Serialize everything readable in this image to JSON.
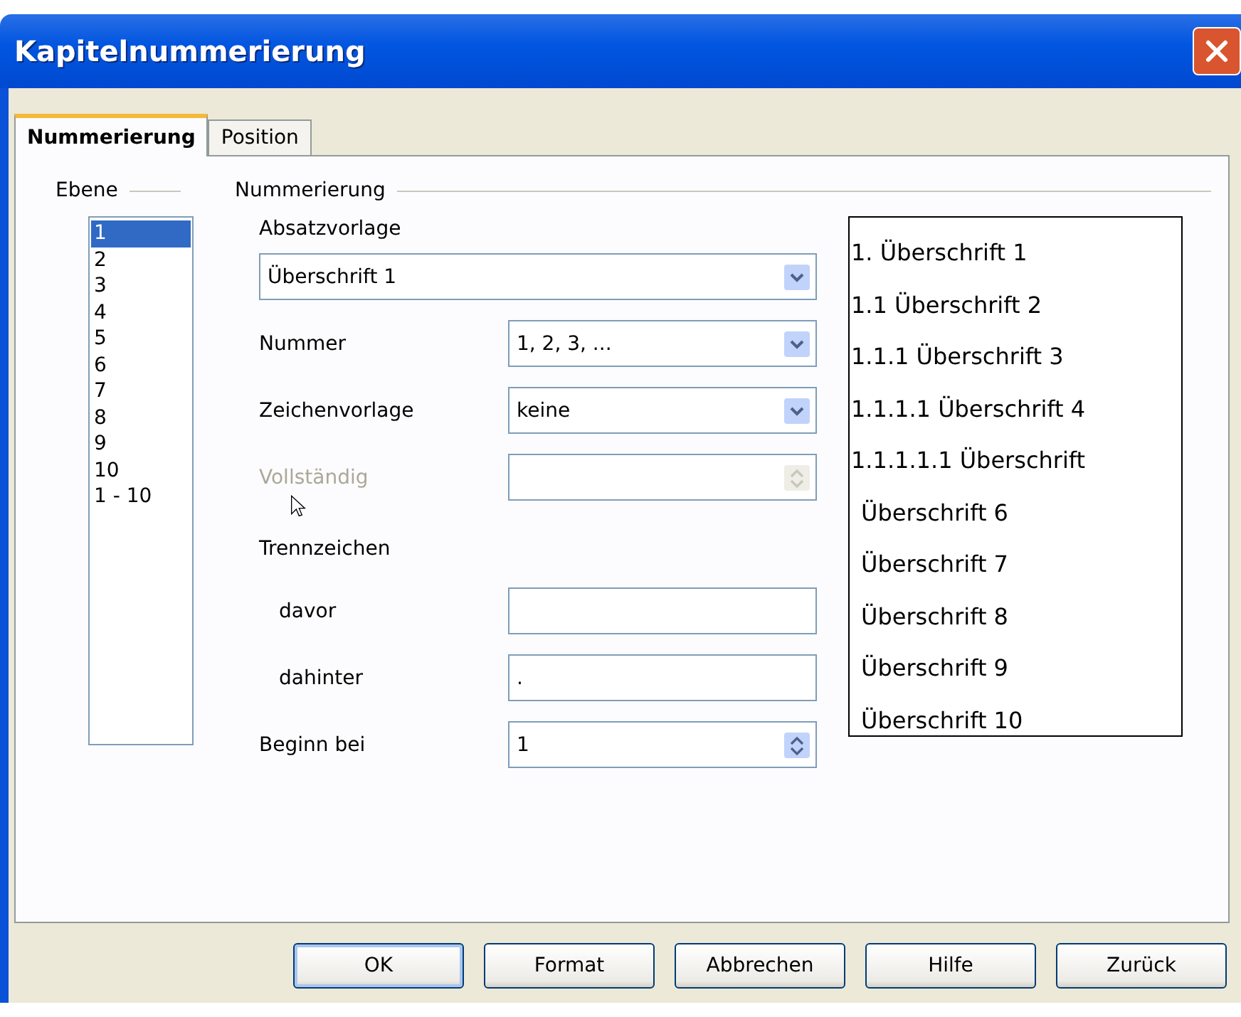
{
  "window": {
    "title": "Kapitelnummerierung"
  },
  "tabs": [
    {
      "label": "Nummerierung",
      "selected": true
    },
    {
      "label": "Position",
      "selected": false
    }
  ],
  "level_group": {
    "title": "Ebene",
    "items": [
      {
        "label": "1",
        "selected": true
      },
      {
        "label": "2",
        "selected": false
      },
      {
        "label": "3",
        "selected": false
      },
      {
        "label": "4",
        "selected": false
      },
      {
        "label": "5",
        "selected": false
      },
      {
        "label": "6",
        "selected": false
      },
      {
        "label": "7",
        "selected": false
      },
      {
        "label": "8",
        "selected": false
      },
      {
        "label": "9",
        "selected": false
      },
      {
        "label": "10",
        "selected": false
      },
      {
        "label": "1 - 10",
        "selected": false
      }
    ]
  },
  "numbering_group": {
    "title": "Nummerierung",
    "paragraph_style": {
      "label": "Absatzvorlage",
      "value": "Überschrift 1"
    },
    "rows": [
      {
        "kind": "combo",
        "label": "Nummer",
        "value": "1, 2, 3, ...",
        "disabled": false,
        "indent": false
      },
      {
        "kind": "combo",
        "label": "Zeichenvorlage",
        "value": "keine",
        "disabled": false,
        "indent": false
      },
      {
        "kind": "spin",
        "label": "Vollständig",
        "disabled": true,
        "indent": false
      },
      {
        "kind": "heading",
        "label": "Trennzeichen"
      },
      {
        "kind": "text",
        "label": "davor",
        "disabled": false,
        "indent": true
      },
      {
        "kind": "text",
        "label": "dahinter",
        "value": ".",
        "disabled": false,
        "indent": true
      },
      {
        "kind": "spin",
        "label": "Beginn bei",
        "value": "1",
        "disabled": false,
        "indent": false
      }
    ]
  },
  "preview": [
    "1. Überschrift 1",
    "1.1 Überschrift 2",
    "1.1.1 Überschrift 3",
    "1.1.1.1 Überschrift 4",
    "1.1.1.1.1 Überschrift",
    "Überschrift 6",
    "Überschrift 7",
    "Überschrift 8",
    "Überschrift 9",
    "Überschrift 10"
  ],
  "buttons": [
    {
      "label": "OK",
      "default": true
    },
    {
      "label": "Format",
      "default": false
    },
    {
      "label": "Abbrechen",
      "default": false
    },
    {
      "label": "Hilfe",
      "default": false
    },
    {
      "label": "Zurück",
      "default": false
    }
  ]
}
